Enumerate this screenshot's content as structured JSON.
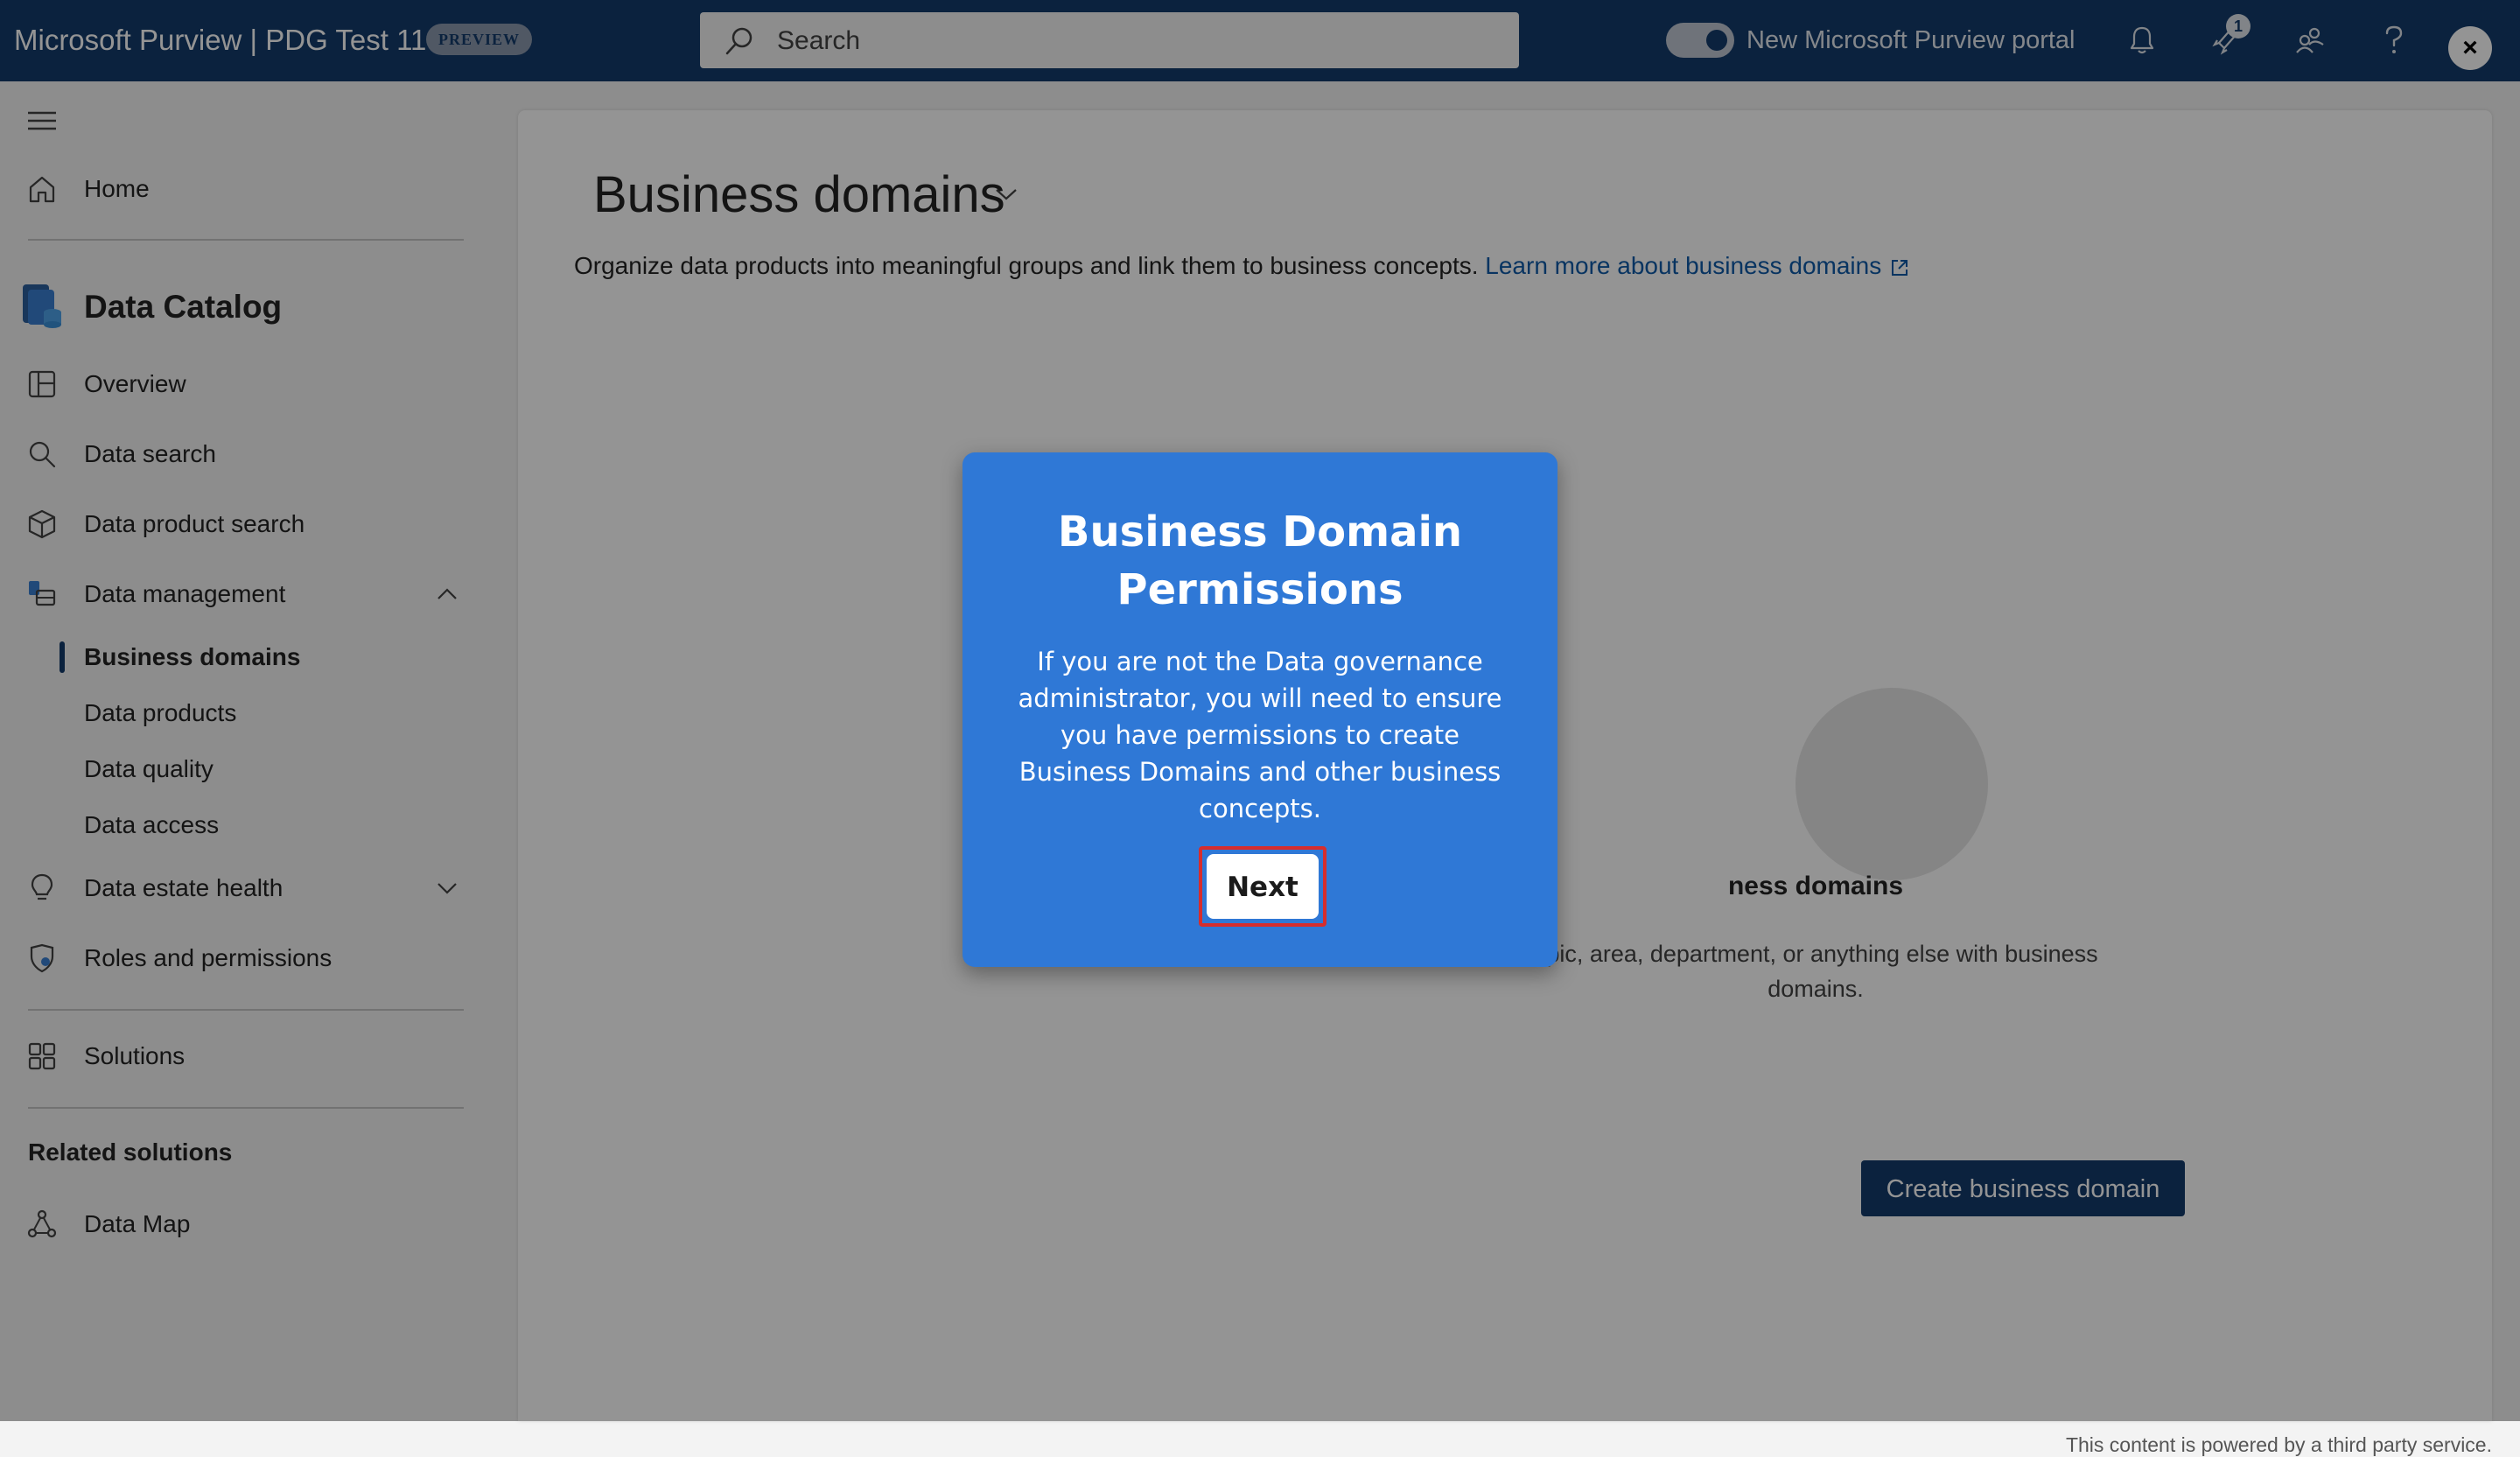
{
  "topbar": {
    "title": "Microsoft Purview | PDG Test 11",
    "badge": "PREVIEW",
    "search_placeholder": "Search",
    "toggle_label": "New Microsoft Purview portal",
    "notification_count": "1",
    "close_symbol": "×",
    "icons": [
      "bell-icon",
      "rocket-icon",
      "people-icon",
      "help-icon"
    ],
    "colors": {
      "bar": "#143b6b",
      "accent": "#0f5aa8"
    }
  },
  "sidebar": {
    "home": "Home",
    "section_title": "Data Catalog",
    "overview": "Overview",
    "data_search": "Data search",
    "data_product_search": "Data product search",
    "data_management": "Data management",
    "sub_items": [
      "Business domains",
      "Data products",
      "Data quality",
      "Data access"
    ],
    "data_estate_health": "Data estate health",
    "roles_permissions": "Roles and permissions",
    "solutions": "Solutions",
    "related_title": "Related solutions",
    "data_map": "Data Map"
  },
  "main": {
    "title": "Business domains",
    "description": "Organize data products into meaningful groups and link them to business concepts.",
    "learn_more": "Learn more about business domains",
    "empty_title": "ness domains",
    "empty_desc": "opic, area, department, or anything else with business domains.",
    "create_button": "Create business domain",
    "footer_note": "This content is powered by a third party service."
  },
  "modal": {
    "title": "Business Domain Permissions",
    "body": "If you are not the Data governance administrator, you will need to ensure you have permissions to create Business Domains and other business concepts.",
    "next_button": "Next",
    "colors": {
      "background": "#2f78d6",
      "highlight": "#d62d2d"
    }
  }
}
